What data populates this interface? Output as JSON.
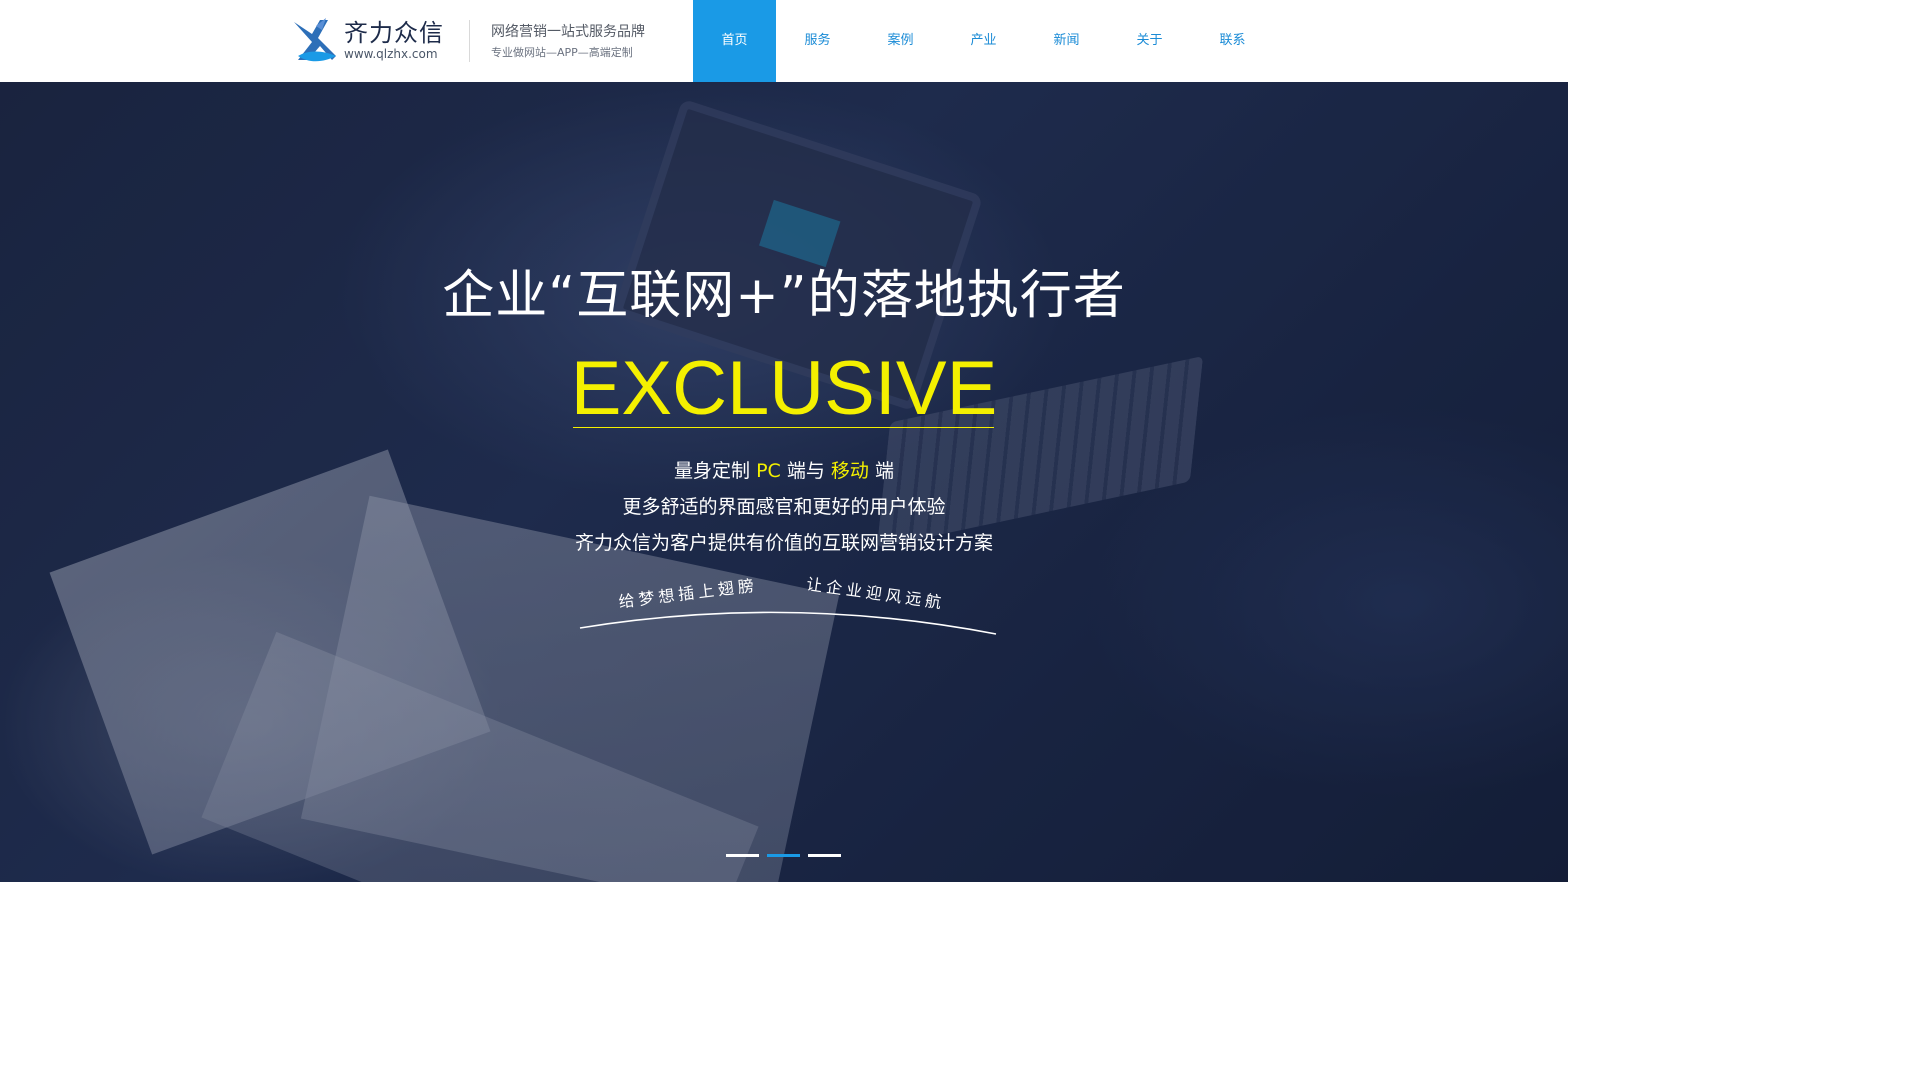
{
  "brand": {
    "name": "齐力众信",
    "url": "www.qlzhx.com",
    "tagline": "网络营销一站式服务品牌",
    "subtagline": "专业做网站—APP—高端定制",
    "logo_icon": "bird-logo-icon"
  },
  "nav": {
    "items": [
      {
        "label": "首页",
        "active": true
      },
      {
        "label": "服务",
        "active": false
      },
      {
        "label": "案例",
        "active": false
      },
      {
        "label": "产业",
        "active": false
      },
      {
        "label": "新闻",
        "active": false
      },
      {
        "label": "关于",
        "active": false
      },
      {
        "label": "联系",
        "active": false
      }
    ]
  },
  "hero": {
    "title": "企业“互联网+”的落地执行者",
    "highlight": "EXCLUSIVE",
    "line1": {
      "prefix": "量身定制 ",
      "pc": "PC",
      "middle": " 端与 ",
      "mobile": "移动",
      "suffix": " 端"
    },
    "line2": "更多舒适的界面感官和更好的用户体验",
    "line3": "齐力众信为客户提供有价值的互联网营销设计方案",
    "slogan_left": "给梦想插上翅膀",
    "slogan_right": "让企业迎风远航"
  },
  "carousel": {
    "total": 3,
    "active_index": 1
  },
  "colors": {
    "accent": "#1a9ae6",
    "highlight": "#f4f000",
    "hero_bg": "#1c2540"
  }
}
